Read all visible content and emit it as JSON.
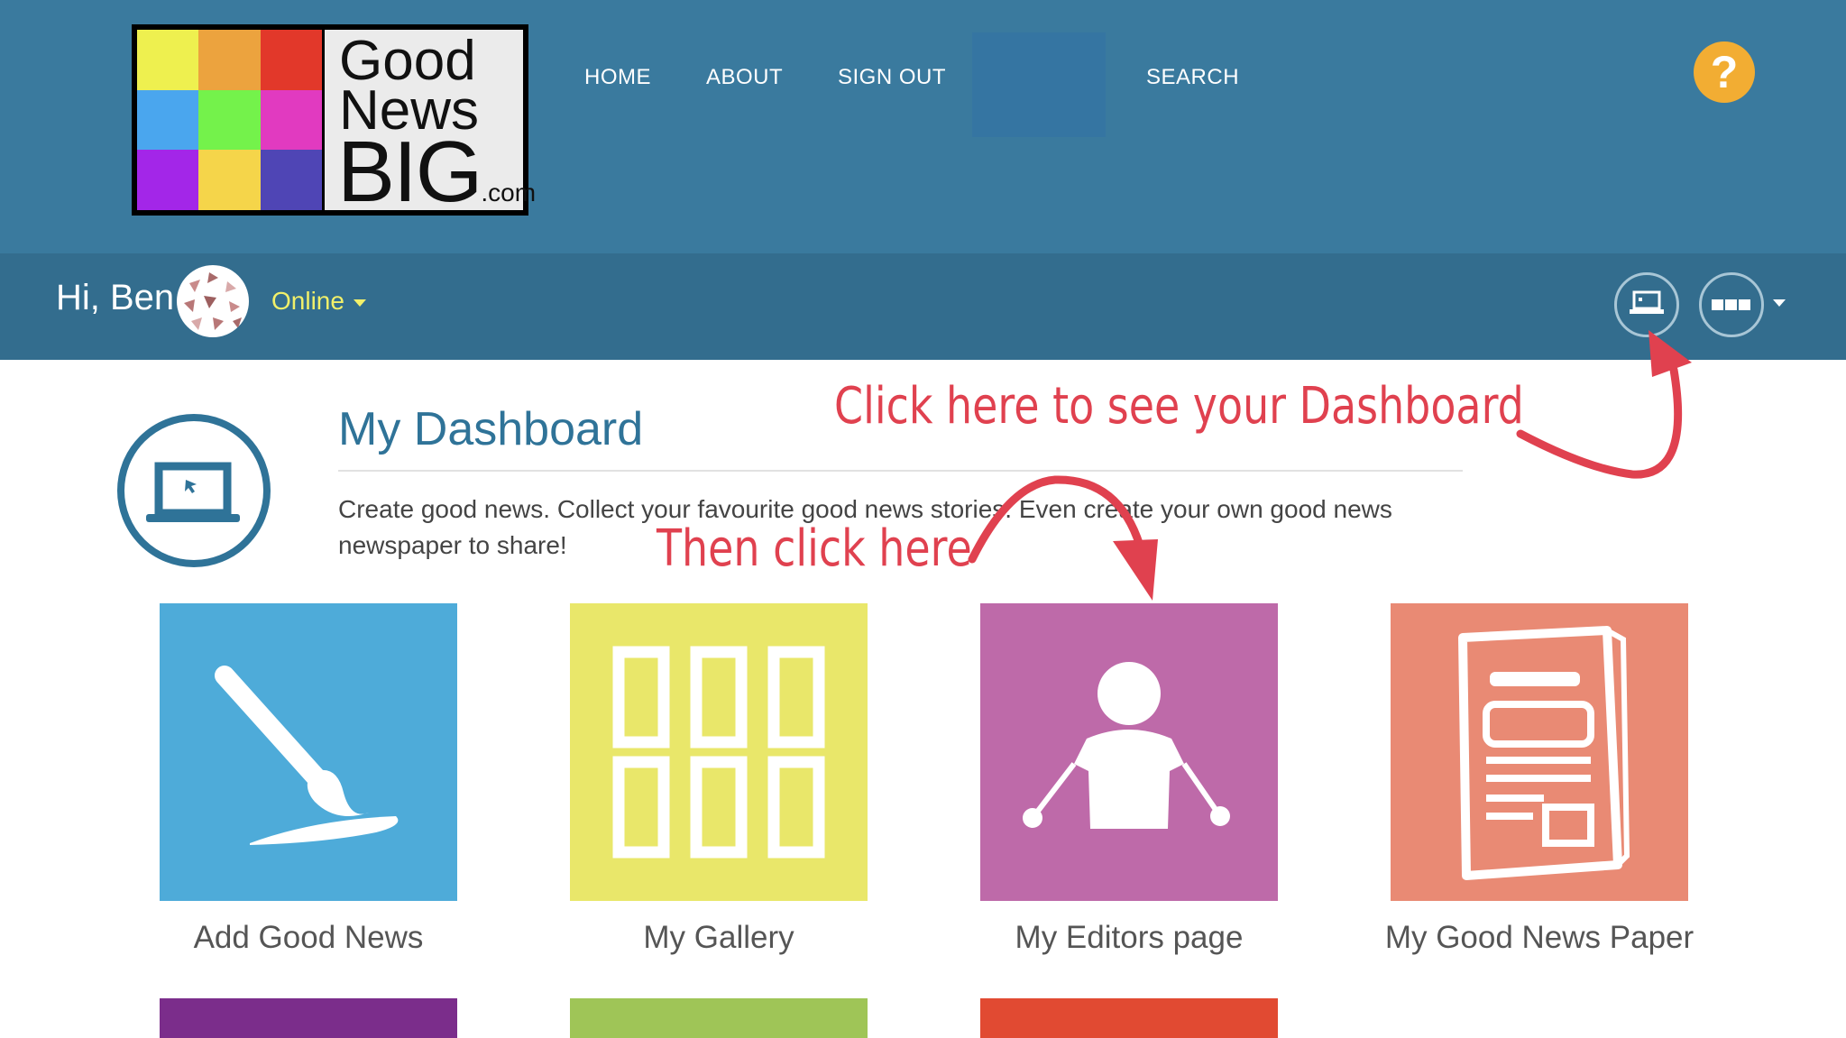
{
  "logo": {
    "line1": "Good",
    "line2": "News",
    "line3": "BIG",
    "suffix": ".com",
    "grid_colors": [
      "#eef04f",
      "#eca33e",
      "#e2382a",
      "#4aa6ee",
      "#74f24b",
      "#e13ac0",
      "#a326e8",
      "#f5d54a",
      "#4f45b5"
    ]
  },
  "nav": {
    "home": "HOME",
    "about": "ABOUT",
    "signout": "SIGN OUT",
    "search": "SEARCH",
    "help_symbol": "?"
  },
  "user": {
    "greeting": "Hi, Ben",
    "status": "Online"
  },
  "toolbar_icons": {
    "dashboard": "laptop-icon",
    "menu": "grid-menu-icon"
  },
  "dashboard": {
    "title": "My Dashboard",
    "description": "Create good news. Collect your favourite good news stories. Even create your own good news newspaper to share!",
    "icon": "laptop-icon"
  },
  "tiles": [
    {
      "label": "Add Good News",
      "color": "#4eabd9",
      "icon": "paintbrush-icon"
    },
    {
      "label": "My Gallery",
      "color": "#e9e76a",
      "icon": "gallery-grid-icon"
    },
    {
      "label": "My Editors page",
      "color": "#be6aa9",
      "icon": "person-icon"
    },
    {
      "label": "My Good News Paper",
      "color": "#e98a74",
      "icon": "newspaper-icon"
    }
  ],
  "partial_tiles": [
    {
      "color": "#7b2d8b"
    },
    {
      "color": "#9fc557"
    },
    {
      "color": "#e14a32"
    }
  ],
  "annotations": {
    "dashboard_hint": "Click here to see your Dashboard",
    "editors_hint": "Then click here",
    "color": "#e0414f"
  },
  "colors": {
    "topbar": "#3a7a9e",
    "userbar": "#336d8e",
    "accent": "#2f7398",
    "help": "#f2ad33"
  }
}
